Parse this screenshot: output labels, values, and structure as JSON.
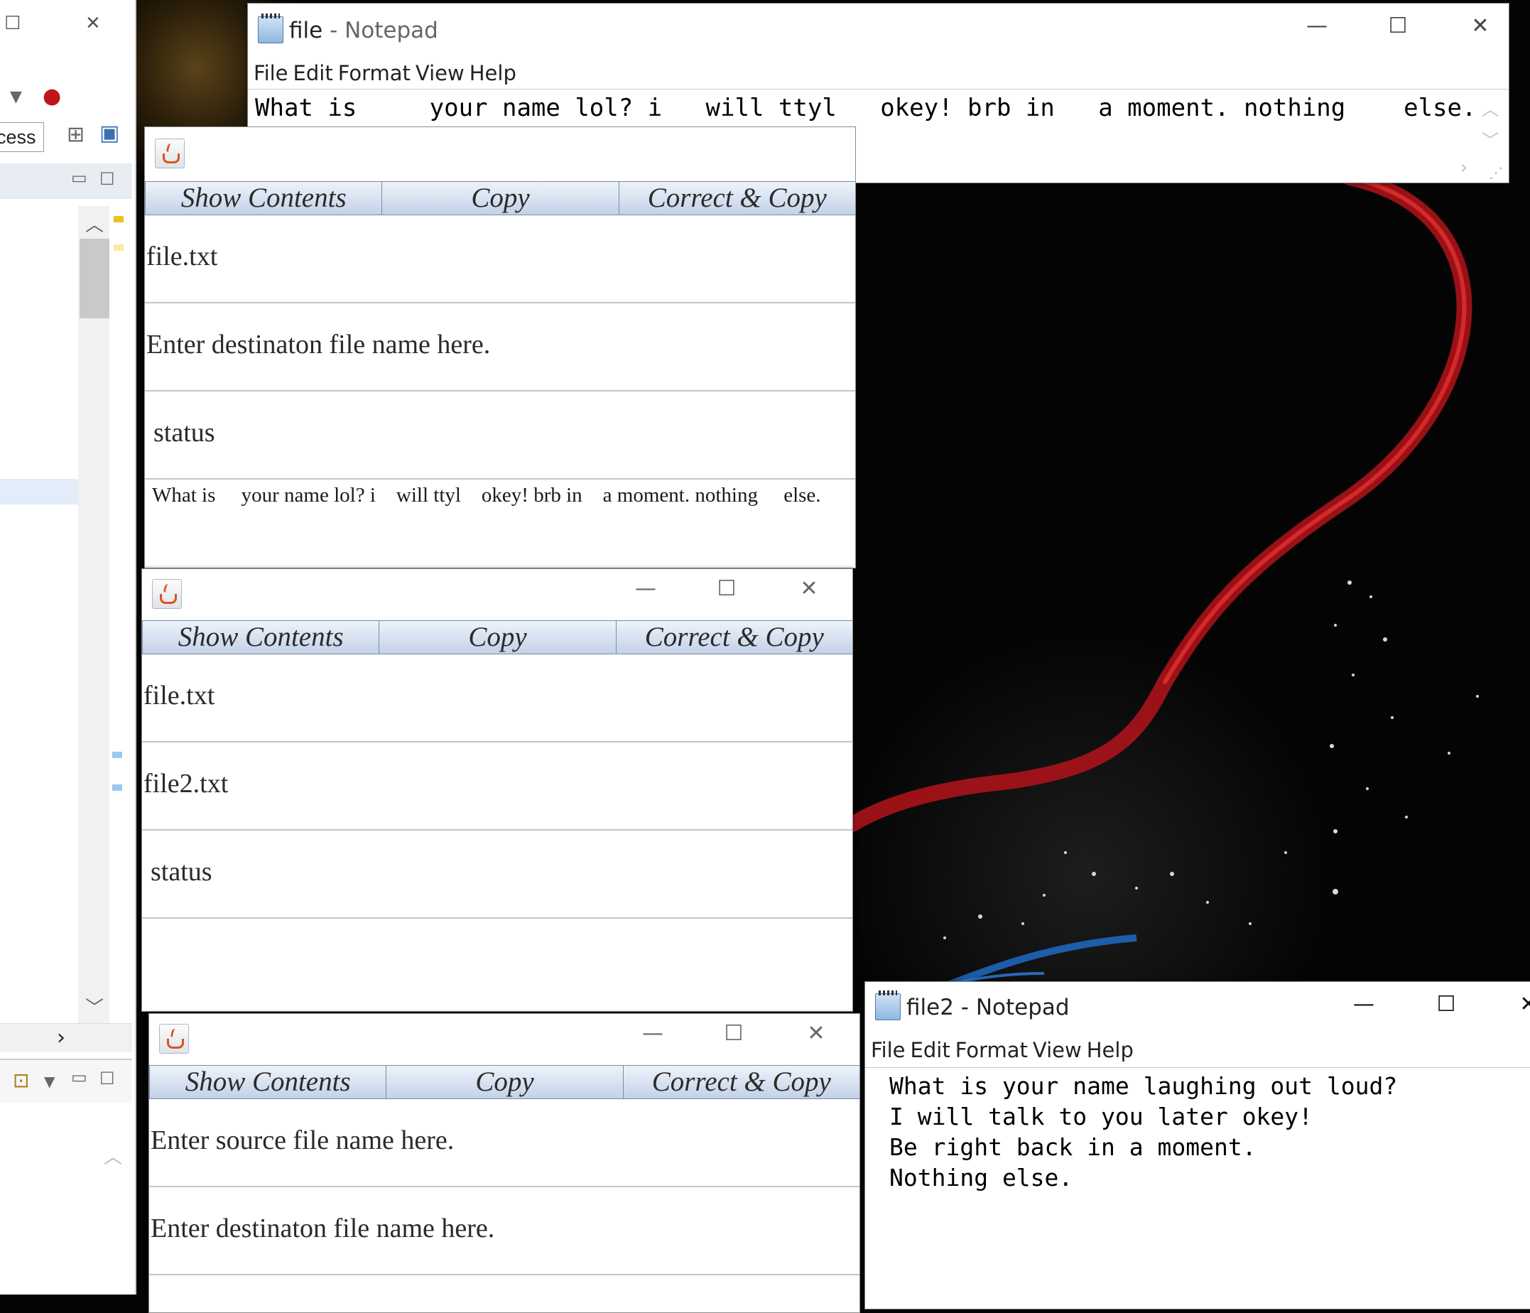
{
  "ide": {
    "access_text": "cess"
  },
  "notepad1": {
    "title_name": "file",
    "title_app": " - Notepad",
    "menu": [
      "File",
      "Edit",
      "Format",
      "View",
      "Help"
    ],
    "content": "What is     your name lol? i   will ttyl   okey! brb in   a moment. nothing    else."
  },
  "notepad2": {
    "title_name": "file2",
    "title_app": " - Notepad",
    "menu": [
      "File",
      "Edit",
      "Format",
      "View",
      "Help"
    ],
    "lines": [
      "What is your name laughing out loud?",
      "I will talk to you later okey!",
      "Be right back in a moment.",
      "Nothing else."
    ]
  },
  "java_buttons": [
    "Show Contents",
    "Copy",
    "Correct & Copy"
  ],
  "java1": {
    "source": "file.txt",
    "destination": "Enter destinaton file name here.",
    "status": "status",
    "output": "What is     your name lol? i    will ttyl    okey! brb in    a moment. nothing     else."
  },
  "java2": {
    "source": "file.txt",
    "destination": "file2.txt",
    "status": "status",
    "output": ""
  },
  "java3": {
    "source": "Enter source file name here.",
    "destination": "Enter destinaton file name here."
  },
  "controls": {
    "minimize": "—",
    "maximize": "☐",
    "close": "✕"
  }
}
